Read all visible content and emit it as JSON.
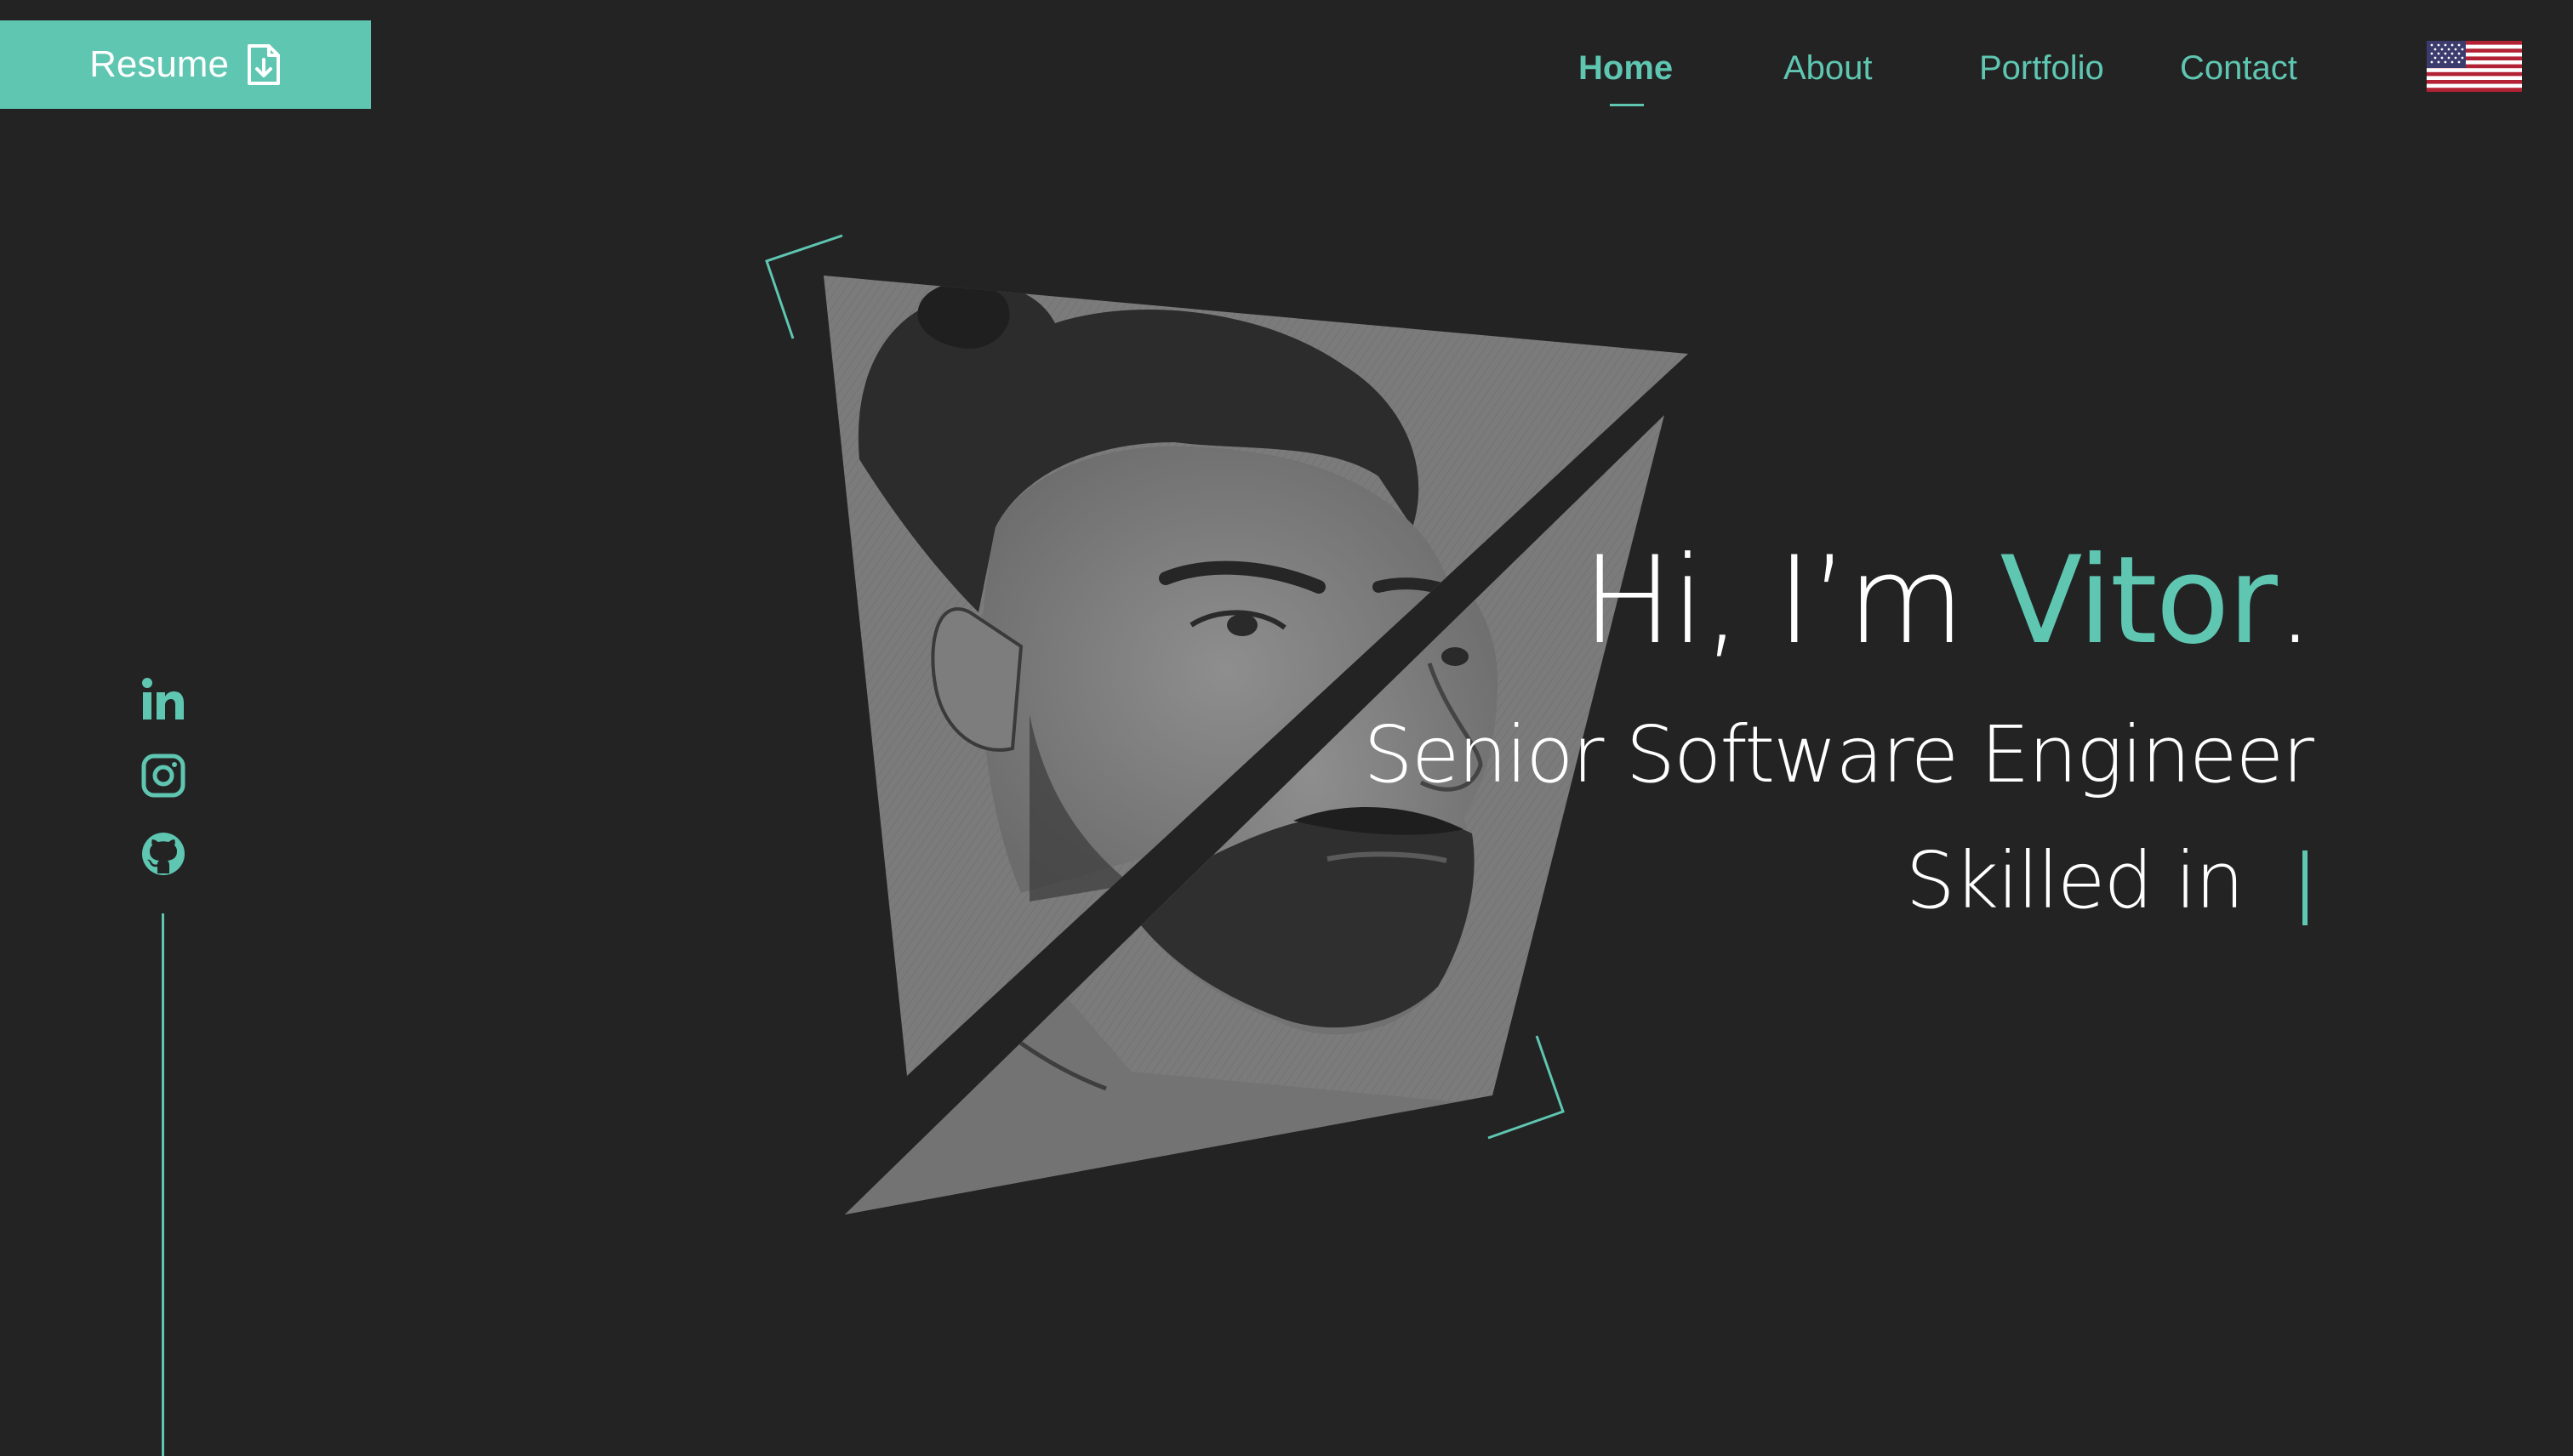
{
  "header": {
    "resume_label": "Resume",
    "nav": {
      "home": "Home",
      "about": "About",
      "portfolio": "Portfolio",
      "contact": "Contact"
    },
    "active_tab": "Home",
    "language_icon": "us-flag-icon"
  },
  "social": {
    "icons": [
      "linkedin-icon",
      "instagram-icon",
      "github-icon"
    ]
  },
  "hero": {
    "greeting": "Hi, I’m ",
    "name": "Vitor",
    "name_suffix": ".",
    "title": "Senior Software Engineer",
    "skills_prefix": "Skilled in"
  },
  "colors": {
    "accent": "#5ec6b1",
    "background": "#232323",
    "text": "#ffffff"
  }
}
